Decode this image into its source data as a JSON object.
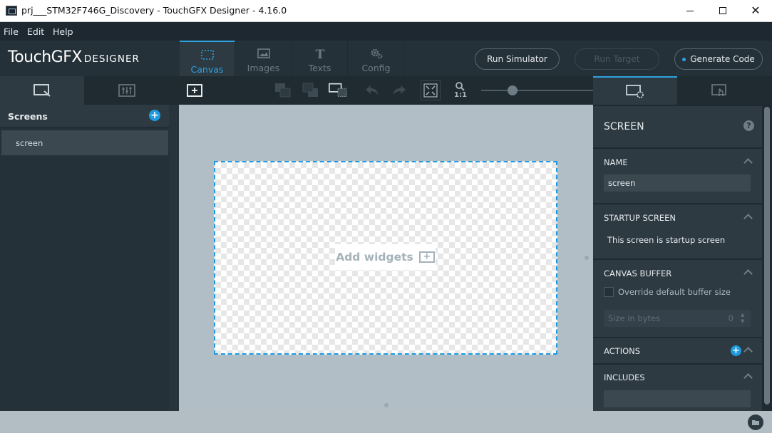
{
  "window": {
    "title": "prj___STM32F746G_Discovery - TouchGFX Designer - 4.16.0"
  },
  "menu": [
    "File",
    "Edit",
    "Help"
  ],
  "logo": {
    "main": "TouchGFX",
    "sub": "DESIGNER"
  },
  "nav_tabs": [
    {
      "label": "Canvas",
      "icon": "canvas-icon",
      "active": true
    },
    {
      "label": "Images",
      "icon": "image-icon",
      "active": false
    },
    {
      "label": "Texts",
      "icon": "text-icon",
      "active": false
    },
    {
      "label": "Config",
      "icon": "gear-icon",
      "active": false
    }
  ],
  "header_buttons": {
    "run_simulator": "Run Simulator",
    "run_target": "Run Target",
    "generate_code": "Generate Code"
  },
  "toolbar": {
    "zoom_ratio": "1:1",
    "zoom_level": 0.28
  },
  "left_panel": {
    "title": "Screens",
    "screens": [
      "screen"
    ]
  },
  "canvas": {
    "placeholder": "Add widgets"
  },
  "properties": {
    "title": "SCREEN",
    "name_section": "NAME",
    "name_value": "screen",
    "startup_section": "STARTUP SCREEN",
    "startup_text": "This screen is startup screen",
    "canvas_buffer_section": "CANVAS BUFFER",
    "override_label": "Override default buffer size",
    "override_checked": false,
    "size_placeholder": "Size in bytes",
    "size_value": "0",
    "actions_section": "ACTIONS",
    "includes_section": "INCLUDES"
  },
  "colors": {
    "accent": "#2fa1e0",
    "panel": "#253139",
    "canvas_bg": "#b1bec5"
  }
}
